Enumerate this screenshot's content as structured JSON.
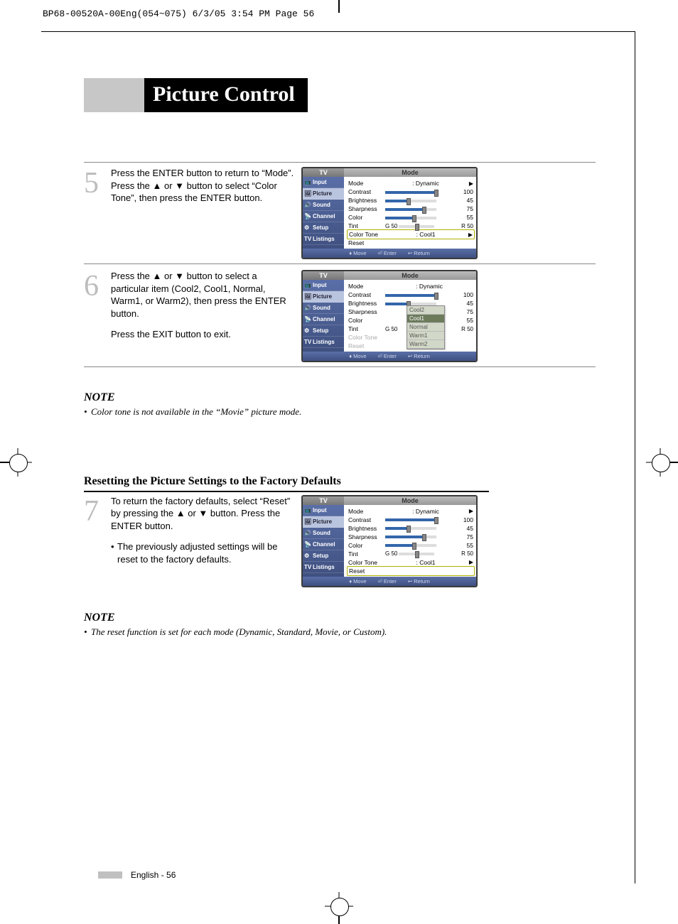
{
  "header_strip": "BP68-00520A-00Eng(054~075)  6/3/05  3:54 PM  Page 56",
  "title": "Picture Control",
  "steps": {
    "s5": {
      "num": "5",
      "text_a": "Press the ENTER button to return to “Mode”.",
      "text_b": "Press the ▲ or ▼ button to select “Color Tone”, then press the ENTER button."
    },
    "s6": {
      "num": "6",
      "text_a": "Press the ▲ or ▼ button to select a particular item (Cool2, Cool1, Normal, Warm1, or Warm2), then press the ENTER button.",
      "text_b": "Press the EXIT button to exit."
    },
    "s7": {
      "num": "7",
      "text_a": "To return the factory defaults, select “Reset” by pressing the ▲ or ▼ button. Press the ENTER button.",
      "bullet": "The previously adjusted settings will be reset to the factory defaults."
    }
  },
  "notes": {
    "heading": "NOTE",
    "note1": "Color tone is not available in the “Movie” picture mode.",
    "note2": "The reset function is set for each mode (Dynamic, Standard, Movie, or Custom)."
  },
  "subheading": "Resetting the Picture Settings to the Factory Defaults",
  "tv": {
    "header_left": "TV",
    "header_right": "Mode",
    "side": [
      "Input",
      "Picture",
      "Sound",
      "Channel",
      "Setup",
      "Listings"
    ],
    "mode_label": "Mode",
    "mode_value": ": Dynamic",
    "rows": {
      "contrast": {
        "label": "Contrast",
        "val": "100",
        "pct": 100
      },
      "brightness": {
        "label": "Brightness",
        "val": "45",
        "pct": 45
      },
      "sharpness": {
        "label": "Sharpness",
        "val": "75",
        "pct": 75
      },
      "color": {
        "label": "Color",
        "val": "55",
        "pct": 55
      }
    },
    "tint": {
      "label": "Tint",
      "left": "G 50",
      "right": "R 50"
    },
    "colortone": {
      "label": "Color Tone",
      "value": ": Cool1"
    },
    "reset": "Reset",
    "footer": {
      "move": "Move",
      "enter": "Enter",
      "return": "Return",
      "move_sym": "♦",
      "enter_sym": "⏎",
      "return_sym": "↩"
    },
    "dropdown": [
      "Cool2",
      "Cool1",
      "Normal",
      "Warm1",
      "Warm2"
    ]
  },
  "footer": "English - 56"
}
